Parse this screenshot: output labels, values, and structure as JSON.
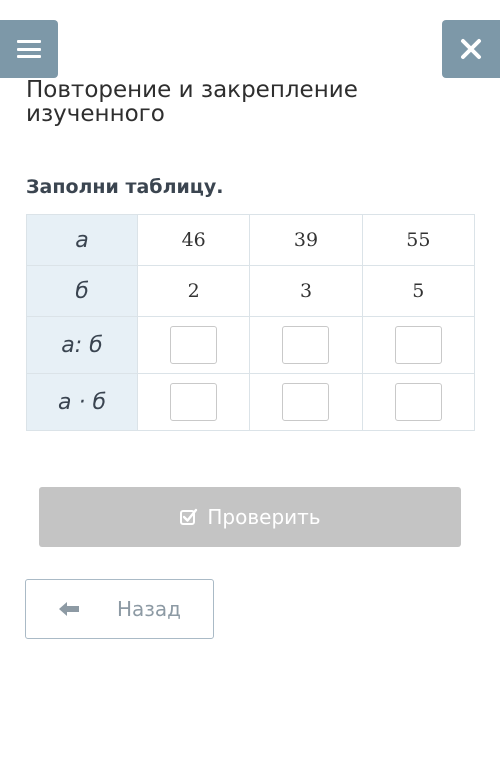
{
  "header": {
    "menu_icon": "hamburger-menu-icon",
    "close_icon": "close-icon"
  },
  "lesson": {
    "title": "Повторение и закрепление изученного",
    "instruction": "Заполни таблицу."
  },
  "table": {
    "rows": [
      {
        "label": "a",
        "cells": [
          "46",
          "39",
          "55"
        ]
      },
      {
        "label": "б",
        "cells": [
          "2",
          "3",
          "5"
        ]
      },
      {
        "label": "a: б",
        "inputs": [
          "",
          "",
          ""
        ]
      },
      {
        "label": "a · б",
        "inputs": [
          "",
          "",
          ""
        ]
      }
    ]
  },
  "buttons": {
    "check_label": "Проверить",
    "check_icon": "check-square-icon",
    "back_label": "Назад",
    "back_icon": "arrow-left-icon"
  },
  "colors": {
    "header_button_bg": "#7d98a8",
    "table_head_bg": "#e7f0f6",
    "check_button_bg": "#c4c4c4",
    "back_button_border": "#aabac6"
  }
}
